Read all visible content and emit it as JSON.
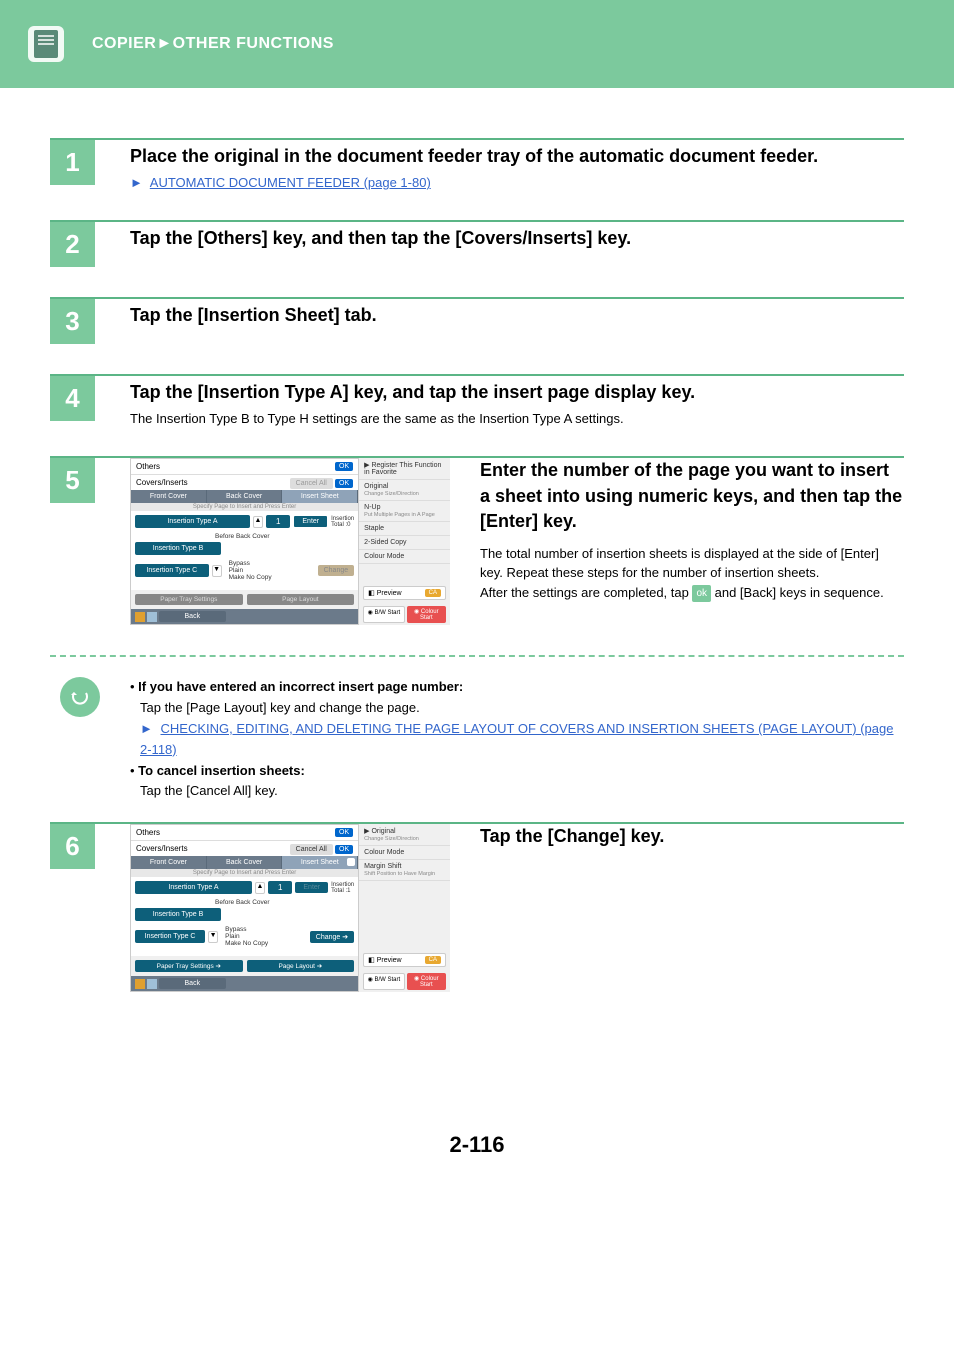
{
  "header": {
    "crumb": "COPIER►OTHER FUNCTIONS"
  },
  "footer": {
    "page": "2-116"
  },
  "steps": {
    "s1": {
      "num": "1",
      "title": "Place the original in the document feeder tray of the automatic document feeder.",
      "link": "AUTOMATIC DOCUMENT FEEDER (page 1-80)"
    },
    "s2": {
      "num": "2",
      "title": "Tap the [Others] key, and then tap the [Covers/Inserts] key."
    },
    "s3": {
      "num": "3",
      "title": "Tap the [Insertion Sheet] tab."
    },
    "s4": {
      "num": "4",
      "title": "Tap the [Insertion Type A] key, and tap the insert page display key.",
      "sub": "The Insertion Type B to Type H settings are the same as the Insertion Type A settings."
    },
    "s5": {
      "num": "5",
      "title": "Enter the number of the page you want to insert a sheet into using numeric keys, and then tap the [Enter] key.",
      "d1": "The total number of insertion sheets is displayed at the side of [Enter] key. Repeat these steps for the number of insertion sheets.",
      "d2a": "After the settings are completed, tap ",
      "d2b": " and [Back] keys in sequence.",
      "ok": "ok"
    },
    "s6": {
      "num": "6",
      "title": "Tap the [Change] key."
    }
  },
  "note": {
    "b1": "If you have entered an incorrect insert page number:",
    "l1": "Tap the [Page Layout] key and change the page.",
    "link": "CHECKING, EDITING, AND DELETING THE PAGE LAYOUT OF COVERS AND INSERTION SHEETS (PAGE LAYOUT) (page 2-118)",
    "b2": "To cancel insertion sheets:",
    "l2": "Tap the [Cancel All] key."
  },
  "panel": {
    "others": "Others",
    "covers": "Covers/Inserts",
    "cancelall": "Cancel All",
    "front": "Front Cover",
    "back_cov": "Back Cover",
    "insert_sheet": "Insert Sheet",
    "hint": "Specify Page to Insert and Press Enter",
    "typeA": "Insertion Type A",
    "typeB": "Insertion Type B",
    "typeC": "Insertion Type C",
    "page1": "1",
    "enter": "Enter",
    "ins_total": "Insertion",
    "total0": "Total  :0",
    "total1": "Total  :1",
    "before_back": "Before Back Cover",
    "bypass": "Bypass",
    "plain": "Plain",
    "makeno": "Make No Copy",
    "change": "Change",
    "papertray": "Paper Tray Settings",
    "pagelayout": "Page Layout",
    "back_btn": "Back",
    "ok": "OK",
    "side_reg": "Register This Function in Favorite",
    "side_orig": "Original",
    "side_orig_sub": "Change Size/Direction",
    "side_nup": "N-Up",
    "side_nup_sub": "Put Multiple Pages in A Page",
    "side_staple": "Staple",
    "side_2side": "2-Sided Copy",
    "side_colour": "Colour Mode",
    "side_margin": "Margin Shift",
    "side_margin_sub": "Shift Position to Have Margin",
    "preview": "Preview",
    "ca": "CA",
    "bw": "B/W Start",
    "colstart": "Colour Start"
  }
}
